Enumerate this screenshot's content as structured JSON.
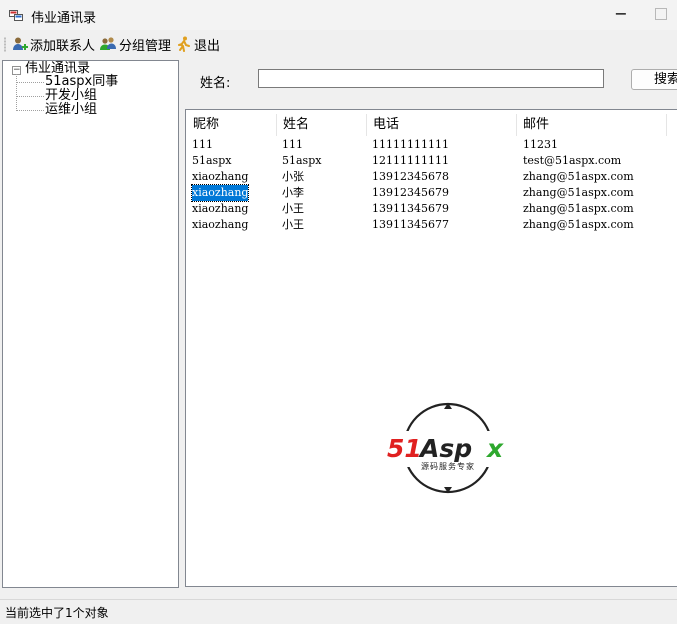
{
  "window": {
    "title": "伟业通讯录"
  },
  "toolbar": {
    "add_contact": "添加联系人",
    "group_manage": "分组管理",
    "exit": "退出"
  },
  "tree": {
    "root": "伟业通讯录",
    "children": [
      "51aspx同事",
      "开发小组",
      "运维小组"
    ]
  },
  "search": {
    "label": "姓名:",
    "value": "",
    "button": "搜索"
  },
  "table": {
    "headers": [
      "昵称",
      "姓名",
      "电话",
      "邮件"
    ],
    "rows": [
      [
        "111",
        "111",
        "11111111111",
        "11231"
      ],
      [
        "51aspx",
        "51aspx",
        "12111111111",
        "test@51aspx.com"
      ],
      [
        "xiaozhang",
        "小张",
        "13912345678",
        "zhang@51aspx.com"
      ],
      [
        "xiaozhang",
        "小李",
        "13912345679",
        "zhang@51aspx.com"
      ],
      [
        "xiaozhang",
        "小王",
        "13911345679",
        "zhang@51aspx.com"
      ],
      [
        "xiaozhang",
        "小王",
        "13911345677",
        "zhang@51aspx.com"
      ]
    ],
    "selected_row": 3
  },
  "watermark": {
    "brand": "51Aspx",
    "tagline": "源码服务专家"
  },
  "status": {
    "text": "当前选中了1个对象"
  },
  "colors": {
    "selection": "#0078d7",
    "logo_red": "#e02020",
    "logo_green": "#2ea82e"
  }
}
